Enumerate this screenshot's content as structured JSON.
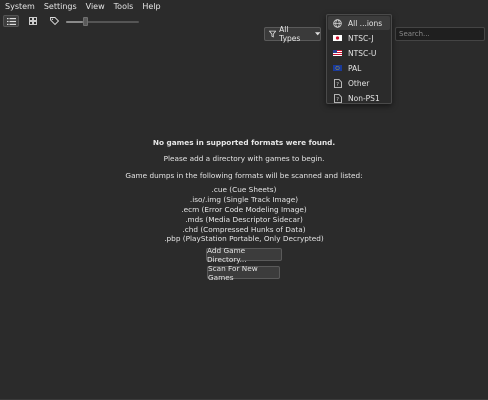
{
  "menu": [
    "System",
    "Settings",
    "View",
    "Tools",
    "Help"
  ],
  "toolbar": {
    "type_filter_label": "All Types",
    "search_placeholder": "Search...",
    "zoom_level": 0.25
  },
  "region_dropdown": {
    "items": [
      {
        "label": "All ...ions",
        "icon": "globe-icon",
        "selected": true
      },
      {
        "label": "NTSC-J",
        "icon": "japan-flag-icon",
        "selected": false
      },
      {
        "label": "NTSC-U",
        "icon": "usa-flag-icon",
        "selected": false
      },
      {
        "label": "PAL",
        "icon": "eu-flag-icon",
        "selected": false
      },
      {
        "label": "Other",
        "icon": "document-icon",
        "selected": false
      },
      {
        "label": "Non-PS1",
        "icon": "document-icon",
        "selected": false
      }
    ]
  },
  "empty_state": {
    "title": "No games in supported formats were found.",
    "subtitle": "Please add a directory with games to begin.",
    "formats_intro": "Game dumps in the following formats will be scanned and listed:",
    "formats": [
      ".cue (Cue Sheets)",
      ".iso/.img (Single Track Image)",
      ".ecm (Error Code Modeling Image)",
      ".mds (Media Descriptor Sidecar)",
      ".chd (Compressed Hunks of Data)",
      ".pbp (PlayStation Portable, Only Decrypted)"
    ],
    "add_button": "Add Game Directory...",
    "scan_button": "Scan For New Games"
  }
}
